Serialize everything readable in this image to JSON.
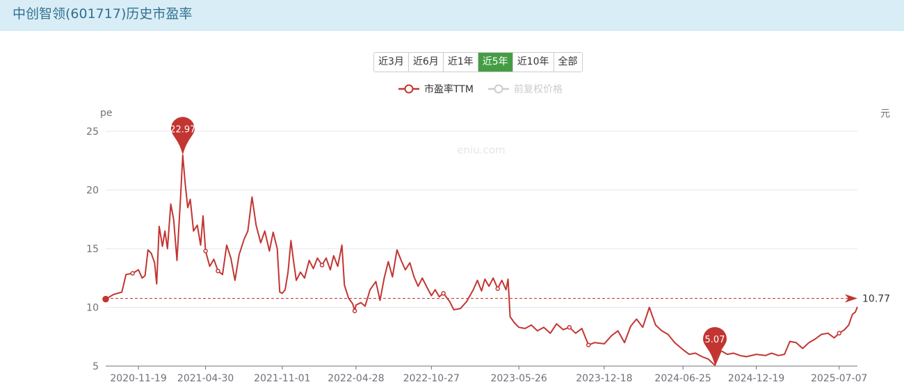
{
  "header": {
    "title": "中创智领(601717)历史市盈率"
  },
  "range_buttons": [
    {
      "label": "近3月",
      "active": false
    },
    {
      "label": "近6月",
      "active": false
    },
    {
      "label": "近1年",
      "active": false
    },
    {
      "label": "近5年",
      "active": true
    },
    {
      "label": "近10年",
      "active": false
    },
    {
      "label": "全部",
      "active": false
    }
  ],
  "legend": [
    {
      "name": "市盈率TTM",
      "active": true
    },
    {
      "name": "前复权价格",
      "active": false
    }
  ],
  "watermark": "eniu.com",
  "colors": {
    "series": "#c23531",
    "inactive": "#cccccc",
    "active_button": "#449d44",
    "header_bg": "#d9edf7",
    "title": "#31708f"
  },
  "chart_data": {
    "type": "line",
    "ylabel": "pe",
    "y2label": "元",
    "ylim": [
      5,
      25
    ],
    "yticks": [
      5,
      10,
      15,
      20,
      25
    ],
    "xlim": [
      "2020-09-01",
      "2025-08-20"
    ],
    "xticks": [
      "2020-11-19",
      "2021-04-30",
      "2021-11-01",
      "2022-04-28",
      "2022-10-27",
      "2023-05-26",
      "2023-12-18",
      "2024-06-25",
      "2024-12-19",
      "2025-07-07"
    ],
    "grid": true,
    "legend_position": "top-center",
    "series": [
      {
        "name": "市盈率TTM",
        "points": [
          [
            "2020-09-01",
            10.7
          ],
          [
            "2020-09-20",
            11.1
          ],
          [
            "2020-10-10",
            11.3
          ],
          [
            "2020-10-20",
            12.8
          ],
          [
            "2020-11-05",
            12.9
          ],
          [
            "2020-11-19",
            13.2
          ],
          [
            "2020-11-28",
            12.5
          ],
          [
            "2020-12-05",
            12.7
          ],
          [
            "2020-12-12",
            14.9
          ],
          [
            "2020-12-20",
            14.6
          ],
          [
            "2020-12-28",
            13.8
          ],
          [
            "2021-01-02",
            12.0
          ],
          [
            "2021-01-08",
            16.9
          ],
          [
            "2021-01-16",
            15.2
          ],
          [
            "2021-01-22",
            16.5
          ],
          [
            "2021-01-28",
            15.0
          ],
          [
            "2021-02-05",
            18.8
          ],
          [
            "2021-02-12",
            17.5
          ],
          [
            "2021-02-20",
            14.0
          ],
          [
            "2021-02-28",
            19.0
          ],
          [
            "2021-03-06",
            22.97
          ],
          [
            "2021-03-12",
            20.5
          ],
          [
            "2021-03-18",
            18.5
          ],
          [
            "2021-03-24",
            19.2
          ],
          [
            "2021-04-01",
            16.5
          ],
          [
            "2021-04-10",
            17.0
          ],
          [
            "2021-04-18",
            15.3
          ],
          [
            "2021-04-24",
            17.8
          ],
          [
            "2021-04-30",
            14.8
          ],
          [
            "2021-05-10",
            13.5
          ],
          [
            "2021-05-20",
            14.1
          ],
          [
            "2021-05-30",
            13.1
          ],
          [
            "2021-06-10",
            12.8
          ],
          [
            "2021-06-20",
            15.3
          ],
          [
            "2021-06-30",
            14.2
          ],
          [
            "2021-07-10",
            12.3
          ],
          [
            "2021-07-20",
            14.5
          ],
          [
            "2021-08-01",
            15.8
          ],
          [
            "2021-08-10",
            16.5
          ],
          [
            "2021-08-20",
            19.4
          ],
          [
            "2021-08-30",
            17.0
          ],
          [
            "2021-09-10",
            15.5
          ],
          [
            "2021-09-20",
            16.5
          ],
          [
            "2021-10-01",
            14.8
          ],
          [
            "2021-10-10",
            16.4
          ],
          [
            "2021-10-20",
            15.0
          ],
          [
            "2021-10-26",
            11.3
          ],
          [
            "2021-11-01",
            11.2
          ],
          [
            "2021-11-08",
            11.5
          ],
          [
            "2021-11-15",
            13.0
          ],
          [
            "2021-11-22",
            15.7
          ],
          [
            "2021-11-28",
            14.0
          ],
          [
            "2021-12-05",
            12.3
          ],
          [
            "2021-12-15",
            13.0
          ],
          [
            "2021-12-25",
            12.5
          ],
          [
            "2022-01-05",
            14.0
          ],
          [
            "2022-01-15",
            13.3
          ],
          [
            "2022-01-25",
            14.2
          ],
          [
            "2022-02-05",
            13.6
          ],
          [
            "2022-02-15",
            14.2
          ],
          [
            "2022-02-25",
            13.2
          ],
          [
            "2022-03-05",
            14.4
          ],
          [
            "2022-03-15",
            13.5
          ],
          [
            "2022-03-25",
            15.3
          ],
          [
            "2022-03-31",
            11.9
          ],
          [
            "2022-04-10",
            10.8
          ],
          [
            "2022-04-20",
            10.3
          ],
          [
            "2022-04-25",
            9.7
          ],
          [
            "2022-04-28",
            10.2
          ],
          [
            "2022-05-10",
            10.4
          ],
          [
            "2022-05-20",
            10.1
          ],
          [
            "2022-06-01",
            11.5
          ],
          [
            "2022-06-15",
            12.2
          ],
          [
            "2022-06-25",
            10.6
          ],
          [
            "2022-07-05",
            12.5
          ],
          [
            "2022-07-15",
            13.9
          ],
          [
            "2022-07-25",
            12.6
          ],
          [
            "2022-08-05",
            14.9
          ],
          [
            "2022-08-15",
            14.0
          ],
          [
            "2022-08-25",
            13.2
          ],
          [
            "2022-09-05",
            13.8
          ],
          [
            "2022-09-15",
            12.6
          ],
          [
            "2022-09-25",
            11.8
          ],
          [
            "2022-10-05",
            12.5
          ],
          [
            "2022-10-15",
            11.8
          ],
          [
            "2022-10-27",
            11.0
          ],
          [
            "2022-11-05",
            11.5
          ],
          [
            "2022-11-15",
            10.9
          ],
          [
            "2022-11-25",
            11.2
          ],
          [
            "2022-12-10",
            10.5
          ],
          [
            "2022-12-20",
            9.8
          ],
          [
            "2023-01-05",
            9.9
          ],
          [
            "2023-01-20",
            10.5
          ],
          [
            "2023-02-05",
            11.5
          ],
          [
            "2023-02-15",
            12.3
          ],
          [
            "2023-02-25",
            11.4
          ],
          [
            "2023-03-05",
            12.4
          ],
          [
            "2023-03-15",
            11.8
          ],
          [
            "2023-03-25",
            12.5
          ],
          [
            "2023-04-05",
            11.6
          ],
          [
            "2023-04-15",
            12.3
          ],
          [
            "2023-04-25",
            11.5
          ],
          [
            "2023-04-30",
            12.4
          ],
          [
            "2023-05-05",
            9.2
          ],
          [
            "2023-05-15",
            8.7
          ],
          [
            "2023-05-26",
            8.3
          ],
          [
            "2023-06-10",
            8.2
          ],
          [
            "2023-06-25",
            8.5
          ],
          [
            "2023-07-10",
            8.0
          ],
          [
            "2023-07-25",
            8.3
          ],
          [
            "2023-08-10",
            7.8
          ],
          [
            "2023-08-25",
            8.6
          ],
          [
            "2023-09-10",
            8.1
          ],
          [
            "2023-09-25",
            8.3
          ],
          [
            "2023-10-10",
            7.8
          ],
          [
            "2023-10-25",
            8.2
          ],
          [
            "2023-11-10",
            6.8
          ],
          [
            "2023-11-25",
            7.0
          ],
          [
            "2023-12-18",
            6.9
          ],
          [
            "2024-01-05",
            7.6
          ],
          [
            "2024-01-20",
            8.0
          ],
          [
            "2024-02-05",
            7.0
          ],
          [
            "2024-02-20",
            8.4
          ],
          [
            "2024-03-05",
            9.0
          ],
          [
            "2024-03-20",
            8.3
          ],
          [
            "2024-04-05",
            10.0
          ],
          [
            "2024-04-20",
            8.5
          ],
          [
            "2024-05-05",
            8.0
          ],
          [
            "2024-05-20",
            7.7
          ],
          [
            "2024-06-05",
            7.0
          ],
          [
            "2024-06-25",
            6.4
          ],
          [
            "2024-07-10",
            6.0
          ],
          [
            "2024-07-25",
            6.1
          ],
          [
            "2024-08-10",
            5.8
          ],
          [
            "2024-08-25",
            5.6
          ],
          [
            "2024-09-10",
            5.07
          ],
          [
            "2024-09-25",
            6.3
          ],
          [
            "2024-10-10",
            6.0
          ],
          [
            "2024-10-25",
            6.1
          ],
          [
            "2024-11-10",
            5.9
          ],
          [
            "2024-11-25",
            5.8
          ],
          [
            "2024-12-19",
            6.0
          ],
          [
            "2025-01-10",
            5.9
          ],
          [
            "2025-01-25",
            6.1
          ],
          [
            "2025-02-10",
            5.9
          ],
          [
            "2025-02-25",
            6.0
          ],
          [
            "2025-03-10",
            7.1
          ],
          [
            "2025-03-25",
            7.0
          ],
          [
            "2025-04-10",
            6.5
          ],
          [
            "2025-04-25",
            7.0
          ],
          [
            "2025-05-10",
            7.3
          ],
          [
            "2025-05-25",
            7.7
          ],
          [
            "2025-06-10",
            7.8
          ],
          [
            "2025-06-25",
            7.4
          ],
          [
            "2025-07-07",
            7.8
          ],
          [
            "2025-07-20",
            8.1
          ],
          [
            "2025-07-30",
            8.5
          ],
          [
            "2025-08-08",
            9.4
          ],
          [
            "2025-08-15",
            9.6
          ],
          [
            "2025-08-20",
            10.05
          ]
        ]
      }
    ],
    "markers": [
      {
        "type": "max",
        "label": "22.97",
        "x": "2021-03-06",
        "y": 22.97
      },
      {
        "type": "min",
        "label": "5.07",
        "x": "2024-09-10",
        "y": 5.07
      }
    ],
    "reference_line": {
      "label": "10.77",
      "value": 10.77
    }
  }
}
